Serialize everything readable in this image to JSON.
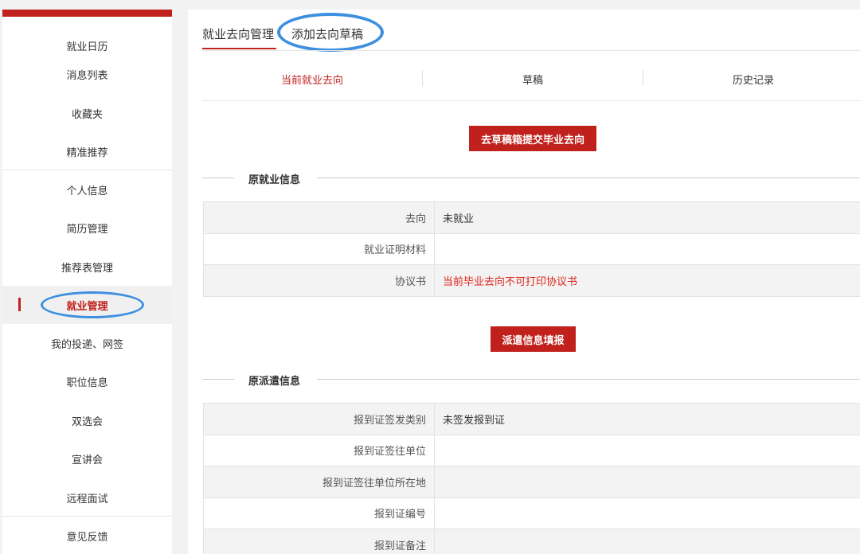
{
  "sidebar": {
    "accent_color": "#c0211c",
    "items": [
      {
        "label": "就业日历"
      },
      {
        "label": "消息列表"
      },
      {
        "label": "收藏夹"
      },
      {
        "label": "精准推荐"
      },
      {
        "label": "个人信息"
      },
      {
        "label": "简历管理"
      },
      {
        "label": "推荐表管理"
      },
      {
        "label": "就业管理",
        "active": true
      },
      {
        "label": "我的投递、网签"
      },
      {
        "label": "职位信息"
      },
      {
        "label": "双选会"
      },
      {
        "label": "宣讲会"
      },
      {
        "label": "远程面试"
      },
      {
        "label": "意见反馈"
      }
    ]
  },
  "main": {
    "tabs": [
      {
        "label": "就业去向管理",
        "active": true
      },
      {
        "label": "添加去向草稿"
      }
    ],
    "subtabs": [
      {
        "label": "当前就业去向",
        "active": true
      },
      {
        "label": "草稿"
      },
      {
        "label": "历史记录"
      }
    ],
    "submit_draft_button": "去草稿箱提交毕业去向",
    "original_employment": {
      "title": "原就业信息",
      "rows": [
        {
          "label": "去向",
          "value": "未就业"
        },
        {
          "label": "就业证明材料",
          "value": ""
        },
        {
          "label": "协议书",
          "value": "当前毕业去向不可打印协议书"
        }
      ]
    },
    "dispatch_button": "派遣信息填报",
    "original_dispatch": {
      "title": "原派遣信息",
      "rows": [
        {
          "label": "报到证签发类别",
          "value": "未签发报到证"
        },
        {
          "label": "报到证签往单位",
          "value": ""
        },
        {
          "label": "报到证签往单位所在地",
          "value": ""
        },
        {
          "label": "报到证编号",
          "value": ""
        },
        {
          "label": "报到证备注",
          "value": ""
        }
      ]
    },
    "highlight_color": "#3d8fe0",
    "warning_color": "#e0221a"
  }
}
